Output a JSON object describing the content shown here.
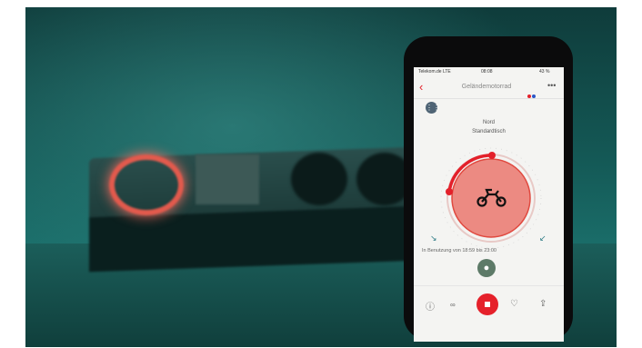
{
  "status_bar": {
    "carrier": "Telekom.de  LTE",
    "time": "08:08",
    "battery": "43 %"
  },
  "nav": {
    "back_icon": "chevron-left-icon",
    "title": "Geländemotorrad",
    "more": "•••",
    "colors": [
      "#e3202a",
      "#2a55c7"
    ]
  },
  "grid_icon": "grid-icon",
  "dial": {
    "zone": "Nord",
    "profile": "Standardtisch",
    "center_icon": "motorcycle-icon",
    "accent": "#e3202a"
  },
  "usage_text": "In Benutzung von 18:59 bis 23:00",
  "user_icon": "person-icon",
  "toolbar": {
    "info_icon": "info-icon",
    "glasses_icon": "glasses-icon",
    "stop_icon": "stop-icon",
    "heart_icon": "heart-icon",
    "share_icon": "share-icon"
  }
}
